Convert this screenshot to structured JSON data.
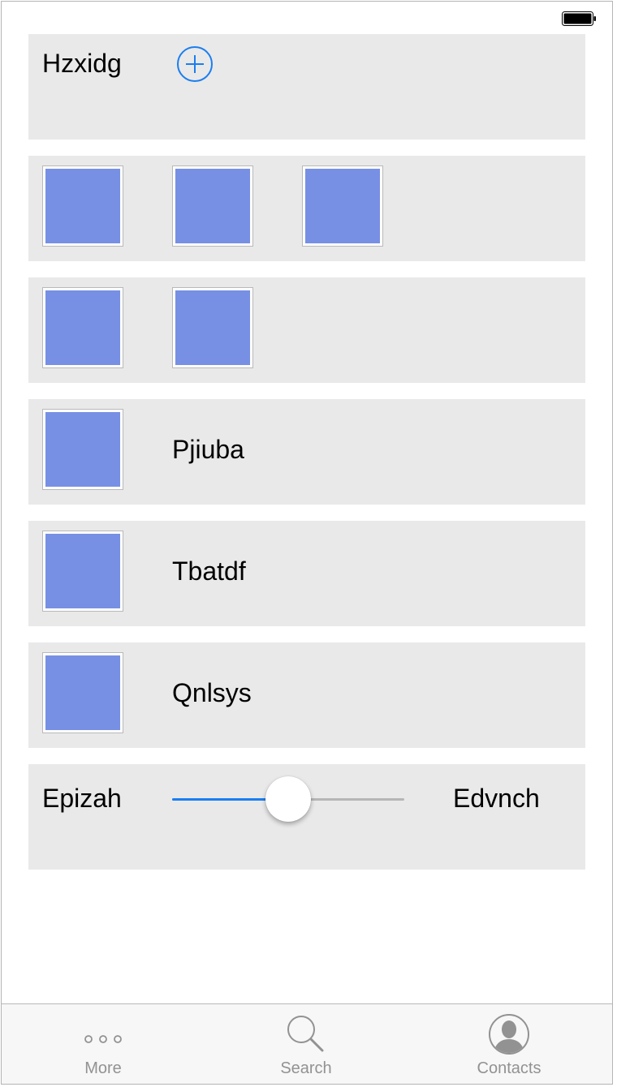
{
  "status_bar": {
    "battery_icon": "battery-full-icon"
  },
  "rows": [
    {
      "type": "header",
      "label": "Hzxidg",
      "action_icon": "add-circle-icon",
      "accent": "#1a7ef0"
    },
    {
      "type": "thumbnails",
      "count": 3
    },
    {
      "type": "thumbnails",
      "count": 2
    },
    {
      "type": "thumb-label",
      "label": "Pjiuba"
    },
    {
      "type": "thumb-label",
      "label": "Tbatdf"
    },
    {
      "type": "thumb-label",
      "label": "Qnlsys"
    },
    {
      "type": "slider",
      "min_label": "Epizah",
      "max_label": "Edvnch",
      "value_fraction": 0.5
    }
  ],
  "tab_bar": {
    "tabs": [
      {
        "label": "More",
        "icon": "more-icon"
      },
      {
        "label": "Search",
        "icon": "search-icon"
      },
      {
        "label": "Contacts",
        "icon": "contacts-icon"
      }
    ]
  },
  "colors": {
    "card_bg": "#e9e9e9",
    "thumb_fill": "#7790e4",
    "accent": "#1a7ef0",
    "tab_text": "#929292"
  }
}
